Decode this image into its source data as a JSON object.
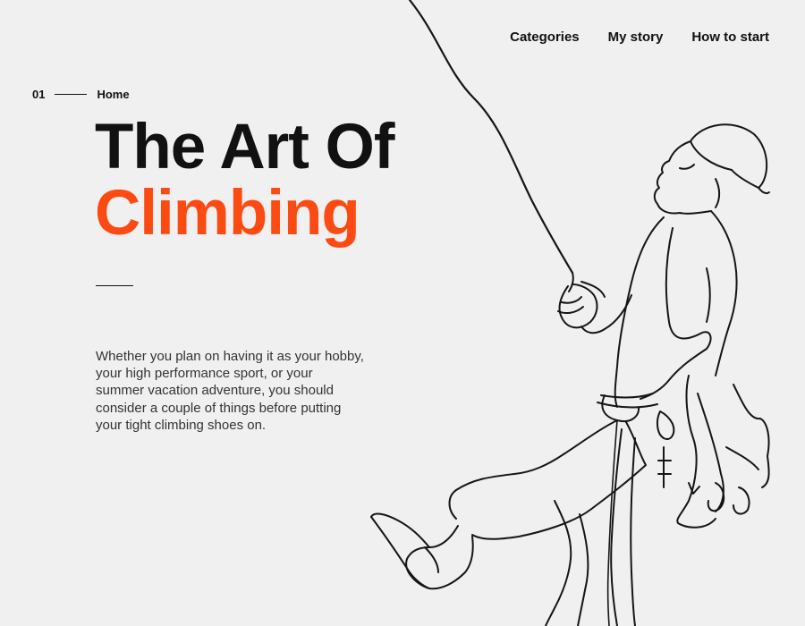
{
  "nav": {
    "items": [
      {
        "label": "Categories"
      },
      {
        "label": "My story"
      },
      {
        "label": "How to start"
      }
    ]
  },
  "breadcrumb": {
    "number": "01",
    "label": "Home"
  },
  "hero": {
    "title_line1": "The Art Of",
    "title_line2": "Climbing",
    "accent_color": "#fb4a12",
    "description": "Whether you plan on having it as your hobby, your high performance sport, or your summer vacation adventure, you should consider a couple of things before putting your tight climbing shoes on."
  },
  "illustration": {
    "icon": "climber-line-art"
  }
}
